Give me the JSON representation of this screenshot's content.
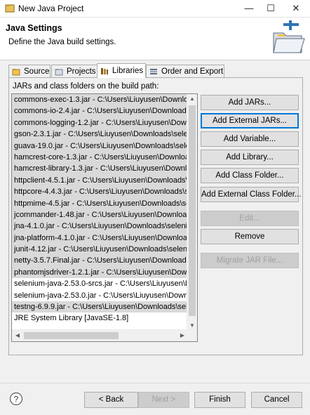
{
  "window": {
    "title": "New Java Project",
    "minimize": "—",
    "maximize": "☐",
    "close": "✕"
  },
  "header": {
    "title": "Java Settings",
    "description": "Define the Java build settings.",
    "banner_icon": "new-java-project-folder-icon"
  },
  "tabs": [
    {
      "label": "Source",
      "icon": "source-folder-icon",
      "active": false
    },
    {
      "label": "Projects",
      "icon": "projects-icon",
      "active": false
    },
    {
      "label": "Libraries",
      "icon": "libraries-icon",
      "active": true
    },
    {
      "label": "Order and Export",
      "icon": "order-export-icon",
      "active": false
    }
  ],
  "libraries": {
    "list_label": "JARs and class folders on the build path:",
    "items": [
      {
        "text": "commons-exec-1.3.jar - C:\\Users\\Liuyusen\\Downloa",
        "selected": true
      },
      {
        "text": "commons-io-2.4.jar - C:\\Users\\Liuyusen\\Downloads",
        "selected": true
      },
      {
        "text": "commons-logging-1.2.jar - C:\\Users\\Liuyusen\\Down",
        "selected": true
      },
      {
        "text": "gson-2.3.1.jar - C:\\Users\\Liuyusen\\Downloads\\seleni",
        "selected": true
      },
      {
        "text": "guava-19.0.jar - C:\\Users\\Liuyusen\\Downloads\\seleni",
        "selected": true
      },
      {
        "text": "hamcrest-core-1.3.jar - C:\\Users\\Liuyusen\\Downloa",
        "selected": true
      },
      {
        "text": "hamcrest-library-1.3.jar - C:\\Users\\Liuyusen\\Downlo",
        "selected": true
      },
      {
        "text": "httpclient-4.5.1.jar - C:\\Users\\Liuyusen\\Downloads\\s",
        "selected": true
      },
      {
        "text": "httpcore-4.4.3.jar - C:\\Users\\Liuyusen\\Downloads\\s",
        "selected": true
      },
      {
        "text": "httpmime-4.5.jar - C:\\Users\\Liuyusen\\Downloads\\se",
        "selected": true
      },
      {
        "text": "jcommander-1.48.jar - C:\\Users\\Liuyusen\\Download",
        "selected": true
      },
      {
        "text": "jna-4.1.0.jar - C:\\Users\\Liuyusen\\Downloads\\seleniu",
        "selected": true
      },
      {
        "text": "jna-platform-4.1.0.jar - C:\\Users\\Liuyusen\\Downloa",
        "selected": true
      },
      {
        "text": "junit-4.12.jar - C:\\Users\\Liuyusen\\Downloads\\seleniu",
        "selected": true
      },
      {
        "text": "netty-3.5.7.Final.jar - C:\\Users\\Liuyusen\\Downloads\\",
        "selected": true
      },
      {
        "text": "phantomjsdriver-1.2.1.jar - C:\\Users\\Liuyusen\\Down",
        "selected": true
      },
      {
        "text": "selenium-java-2.53.0-srcs.jar - C:\\Users\\Liuyusen\\Do",
        "selected": false
      },
      {
        "text": "selenium-java-2.53.0.jar - C:\\Users\\Liuyusen\\Downlo",
        "selected": false
      },
      {
        "text": "testng-6.9.9.jar - C:\\Users\\Liuyusen\\Downloads\\sele",
        "selected": true
      },
      {
        "text": "JRE System Library [JavaSE-1.8]",
        "selected": false
      }
    ],
    "scroll_up": "▲",
    "scroll_down": "▼",
    "scroll_left": "◀",
    "scroll_right": "▶"
  },
  "buttons": {
    "add_jars": "Add JARs...",
    "add_external_jars": "Add External JARs...",
    "add_variable": "Add Variable...",
    "add_library": "Add Library...",
    "add_class_folder": "Add Class Folder...",
    "add_external_class_folder": "Add External Class Folder...",
    "edit": "Edit...",
    "remove": "Remove",
    "migrate_jar": "Migrate JAR File..."
  },
  "footer": {
    "help": "?",
    "back": "< Back",
    "next": "Next >",
    "finish": "Finish",
    "cancel": "Cancel"
  },
  "colors": {
    "selection": "#d9d9d9",
    "focus_border": "#0078d7",
    "folder_yellow": "#f2c14e"
  }
}
